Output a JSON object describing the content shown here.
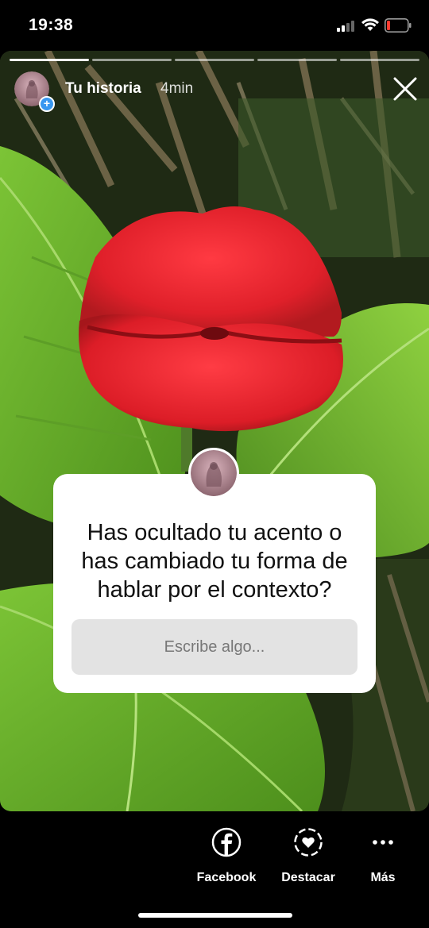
{
  "status_bar": {
    "time": "19:38"
  },
  "story": {
    "user": "Tu historia",
    "time_ago": "4min",
    "segments": 5
  },
  "sticker": {
    "question": "Has ocultado tu acento o has cambiado tu forma de hablar por el contexto?",
    "placeholder": "Escribe algo..."
  },
  "actions": [
    {
      "label": "Facebook",
      "icon": "facebook-icon"
    },
    {
      "label": "Destacar",
      "icon": "highlight-heart-icon"
    },
    {
      "label": "Más",
      "icon": "more-icon"
    }
  ],
  "colors": {
    "badge": "#3897f0",
    "lips": "#e0242b",
    "leaf": "#6fb52a",
    "battery_low": "#ff3b30"
  }
}
